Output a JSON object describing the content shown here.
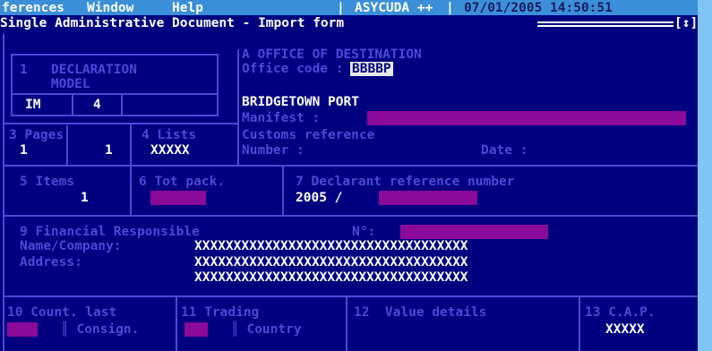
{
  "menu": {
    "items": [
      "ferences",
      "Window",
      "Help"
    ],
    "app_name": "ASYCUDA ++",
    "datetime": "07/01/2005 14:50:51"
  },
  "window": {
    "title": "Single Administrative Document - Import form",
    "indicator": "[↕]"
  },
  "declaration": {
    "label_line1": "1   DECLARATION",
    "label_line2": "    MODEL",
    "type": "IM",
    "model": "4"
  },
  "destination": {
    "label": "A OFFICE OF DESTINATION",
    "office_code_label": "Office code :",
    "office_code": "BBBBP",
    "office_name": "BRIDGETOWN PORT",
    "manifest_label": "Manifest :"
  },
  "pages": {
    "label": "3 Pages",
    "current": "1",
    "total": "1"
  },
  "lists": {
    "label": "4 Lists",
    "value": "XXXXX"
  },
  "customs_reference": {
    "label": "Customs reference",
    "number_label": "Number :",
    "date_label": "Date :"
  },
  "items": {
    "label": "5 Items",
    "value": "1"
  },
  "tot_pack": {
    "label": "6 Tot pack."
  },
  "declarant_ref": {
    "label": "7 Declarant reference number",
    "year": "2005 /"
  },
  "financial": {
    "label": "9 Financial Responsible",
    "no_label": "N°:",
    "name_label": "Name/Company:",
    "address_label": "Address:",
    "name_value": "XXXXXXXXXXXXXXXXXXXXXXXXXXXXXXXXXXX",
    "address_line1": "XXXXXXXXXXXXXXXXXXXXXXXXXXXXXXXXXXX",
    "address_line2": "XXXXXXXXXXXXXXXXXXXXXXXXXXXXXXXXXXX"
  },
  "count_last": {
    "label_line1": "10 Count. last",
    "label_line2": "Consign."
  },
  "trading": {
    "label_line1": "11 Trading",
    "label_line2": "Country"
  },
  "value_details": {
    "label": "12  Value details"
  },
  "cap": {
    "label": "13 C.A.P.",
    "value": "XXXXX"
  },
  "colors": {
    "background": "#000080",
    "label": "#4a4ad8",
    "value": "#ffffff",
    "input_field": "#8b0a9a",
    "menubar": "#3a8fd8",
    "outer_frame": "#7fc6f7"
  }
}
